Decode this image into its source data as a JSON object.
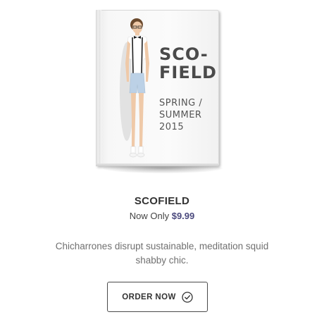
{
  "product": {
    "cover": {
      "title": "SCO-\nFIELD",
      "subtitle": "SPRING / SUMMER 2015",
      "image": "model-woman-suspenders-shorts"
    },
    "name": "SCOFIELD",
    "price_prefix": "Now Only",
    "price": "$9.99",
    "description": "Chicharrones disrupt sustainable, meditation squid shabby chic.",
    "order_button": {
      "label": "ORDER NOW",
      "icon": "check-circle-icon"
    }
  },
  "colors": {
    "price": "#4b4a7e",
    "button_border": "#4a4a4a",
    "text": "#333333",
    "description": "#707070"
  }
}
